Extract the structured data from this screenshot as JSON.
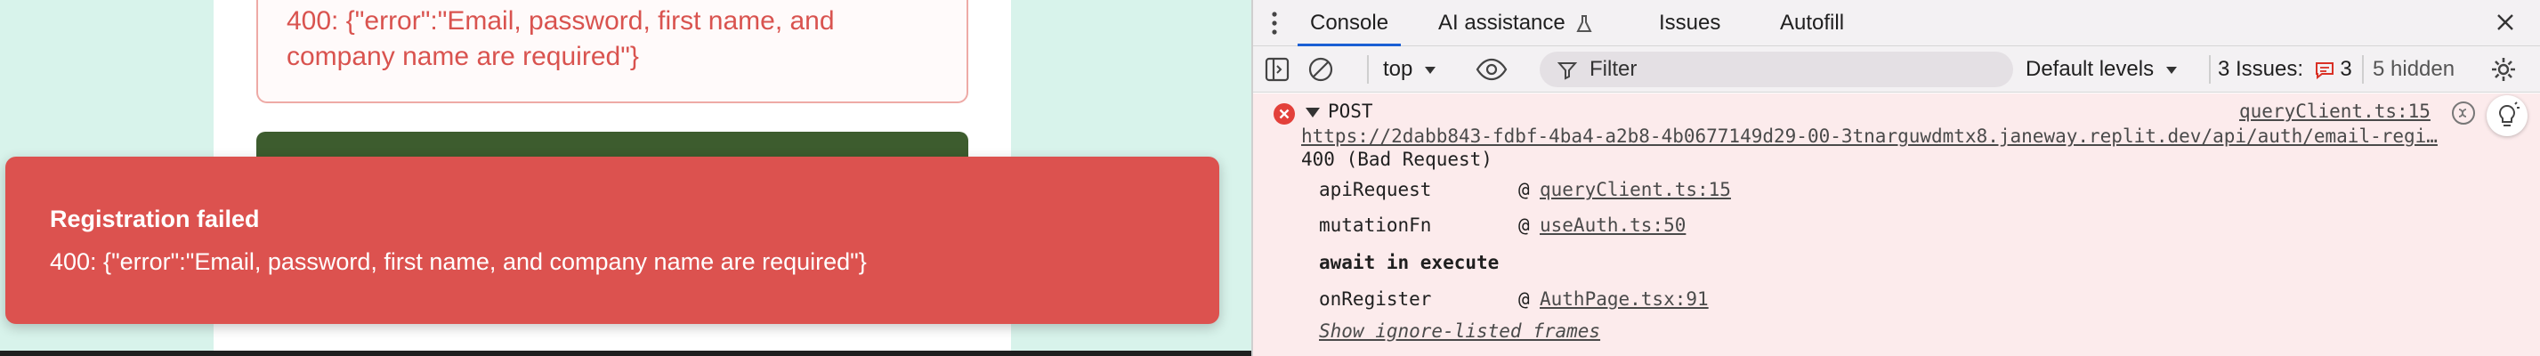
{
  "app": {
    "form_error_text": "400: {\"error\":\"Email, password, first name, and company name are required\"}",
    "toast": {
      "title": "Registration failed",
      "message": "400: {\"error\":\"Email, password, first name, and company name are required\"}"
    }
  },
  "devtools": {
    "tabs": [
      {
        "label": "Console"
      },
      {
        "label": "AI assistance"
      },
      {
        "label": "Issues"
      },
      {
        "label": "Autofill"
      }
    ],
    "toolbar": {
      "context": "top",
      "filter_placeholder": "Filter",
      "levels": "Default levels",
      "issues_label": "3 Issues:",
      "issues_count": "3",
      "hidden_label": "5 hidden"
    },
    "console": {
      "method": "POST",
      "url": "https://2dabb843-fdbf-4ba4-a2b8-4b0677149d29-00-3tnarguwdmtx8.janeway.replit.dev/api/auth/email-regi…",
      "source": "queryClient.ts:15",
      "status": "400 (Bad Request)",
      "stack": [
        {
          "fn": "apiRequest",
          "at": "@",
          "loc": "queryClient.ts:15"
        },
        {
          "fn": "mutationFn",
          "at": "@",
          "loc": "useAuth.ts:50"
        },
        {
          "fn": "onRegister",
          "at": "@",
          "loc": "AuthPage.tsx:91"
        }
      ],
      "await_label": "await in execute",
      "ignore_link": "Show ignore-listed frames"
    },
    "colors": {
      "error_bg": "#fcebec",
      "toast_bg": "#dc524f",
      "active_tab": "#1a5fd4"
    }
  }
}
